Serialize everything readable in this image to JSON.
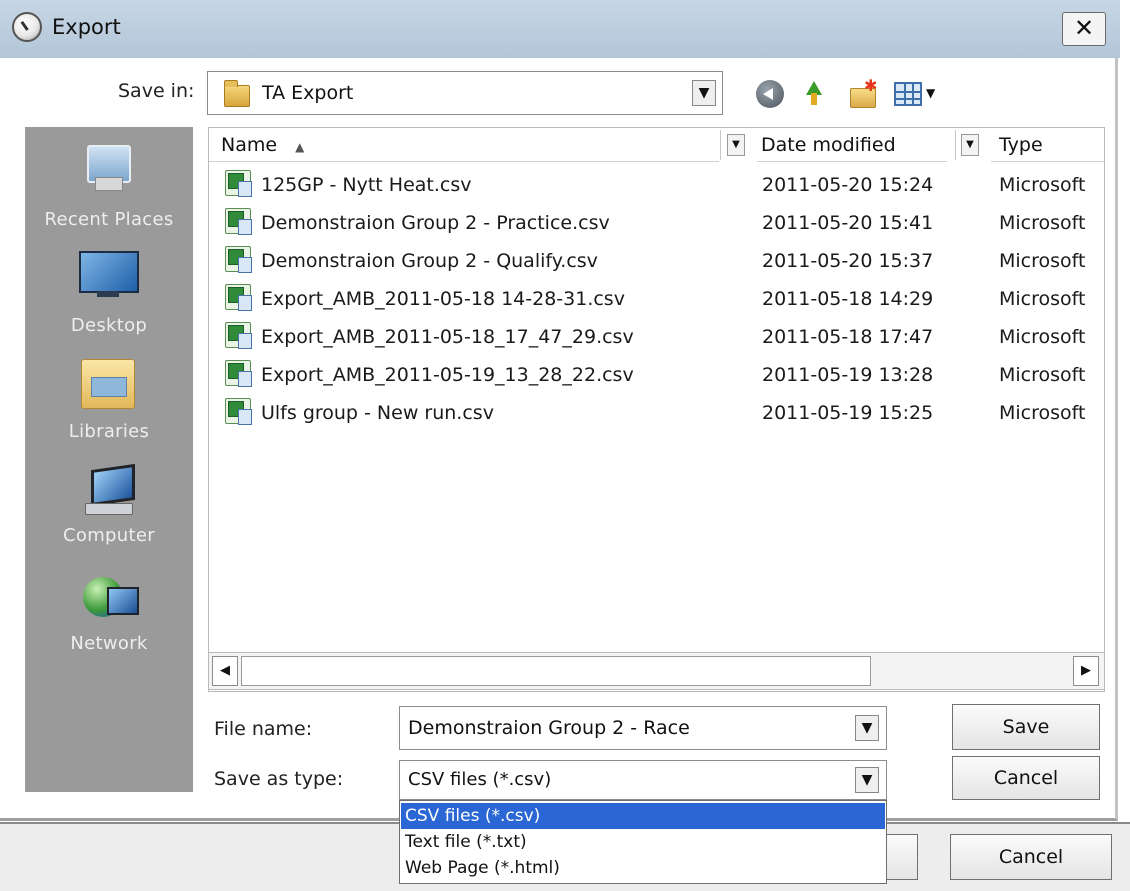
{
  "window": {
    "title": "Export",
    "icon": "export-clock-icon",
    "close_label": "✕"
  },
  "save_in": {
    "label": "Save in:",
    "value": "TA Export"
  },
  "toolbar": {
    "icons": [
      "back-icon",
      "up-folder-icon",
      "new-folder-icon",
      "views-menu-icon"
    ]
  },
  "places": [
    {
      "label": "Recent Places",
      "icon": "recent-places-icon"
    },
    {
      "label": "Desktop",
      "icon": "desktop-icon"
    },
    {
      "label": "Libraries",
      "icon": "libraries-icon"
    },
    {
      "label": "Computer",
      "icon": "computer-icon"
    },
    {
      "label": "Network",
      "icon": "network-icon"
    }
  ],
  "file_list": {
    "columns": {
      "name": "Name",
      "date_modified": "Date modified",
      "type": "Type"
    },
    "sort_indicator": "▲",
    "rows": [
      {
        "name": "125GP - Nytt Heat.csv",
        "date": "2011-05-20 15:24",
        "type": "Microsoft"
      },
      {
        "name": "Demonstraion Group 2 - Practice.csv",
        "date": "2011-05-20 15:41",
        "type": "Microsoft"
      },
      {
        "name": "Demonstraion Group 2 - Qualify.csv",
        "date": "2011-05-20 15:37",
        "type": "Microsoft"
      },
      {
        "name": "Export_AMB_2011-05-18 14-28-31.csv",
        "date": "2011-05-18 14:29",
        "type": "Microsoft"
      },
      {
        "name": "Export_AMB_2011-05-18_17_47_29.csv",
        "date": "2011-05-18 17:47",
        "type": "Microsoft"
      },
      {
        "name": "Export_AMB_2011-05-19_13_28_22.csv",
        "date": "2011-05-19 13:28",
        "type": "Microsoft"
      },
      {
        "name": "Ulfs group - New run.csv",
        "date": "2011-05-19 15:25",
        "type": "Microsoft"
      }
    ]
  },
  "scrollbar": {
    "left_arrow": "◀",
    "right_arrow": "▶"
  },
  "file_name": {
    "label": "File name:",
    "value": "Demonstraion Group 2 - Race"
  },
  "save_as_type": {
    "label": "Save as type:",
    "value": "CSV files (*.csv)",
    "options": [
      "CSV files (*.csv)",
      "Text file (*.txt)",
      "Web Page (*.html)"
    ],
    "selected_index": 0
  },
  "buttons": {
    "save": "Save",
    "cancel": "Cancel",
    "background_cancel": "Cancel"
  }
}
